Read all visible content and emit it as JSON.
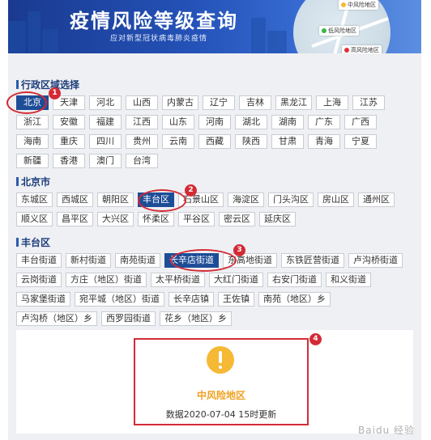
{
  "banner": {
    "title": "疫情风险等级查询",
    "subtitle": "应对新型冠状病毒肺炎疫情",
    "pins": [
      "中风险地区",
      "低风险地区",
      "高风险地区"
    ]
  },
  "province_section": {
    "title": "行政区域选择",
    "selected": "北京",
    "items": [
      "北京",
      "天津",
      "河北",
      "山西",
      "内蒙古",
      "辽宁",
      "吉林",
      "黑龙江",
      "上海",
      "江苏",
      "浙江",
      "安徽",
      "福建",
      "江西",
      "山东",
      "河南",
      "湖北",
      "湖南",
      "广东",
      "广西",
      "海南",
      "重庆",
      "四川",
      "贵州",
      "云南",
      "西藏",
      "陕西",
      "甘肃",
      "青海",
      "宁夏",
      "新疆",
      "香港",
      "澳门",
      "台湾"
    ]
  },
  "city_section": {
    "title": "北京市",
    "selected": "丰台区",
    "items": [
      "东城区",
      "西城区",
      "朝阳区",
      "丰台区",
      "石景山区",
      "海淀区",
      "门头沟区",
      "房山区",
      "通州区",
      "顺义区",
      "昌平区",
      "大兴区",
      "怀柔区",
      "平谷区",
      "密云区",
      "延庆区"
    ]
  },
  "street_section": {
    "title": "丰台区",
    "selected": "长辛店街道",
    "items": [
      "丰台街道",
      "新村街道",
      "南苑街道",
      "长辛店街道",
      "东高地街道",
      "东铁匠营街道",
      "卢沟桥街道",
      "云岗街道",
      "方庄（地区）街道",
      "太平桥街道",
      "大红门街道",
      "右安门街道",
      "和义街道",
      "马家堡街道",
      "宛平城（地区）街道",
      "长辛店镇",
      "王佐镇",
      "南苑（地区）乡",
      "卢沟桥（地区）乡",
      "西罗园街道",
      "花乡（地区）乡"
    ]
  },
  "annotations": [
    "1",
    "2",
    "3",
    "4"
  ],
  "result": {
    "level": "中风险地区",
    "update_text": "数据2020-07-04 15时更新"
  },
  "watermark": "Baidu 经验",
  "colors": {
    "selected_bg": "#1e4d97",
    "annotation": "#d32b36",
    "warning": "#f5b935",
    "level_text": "#f0a020"
  }
}
